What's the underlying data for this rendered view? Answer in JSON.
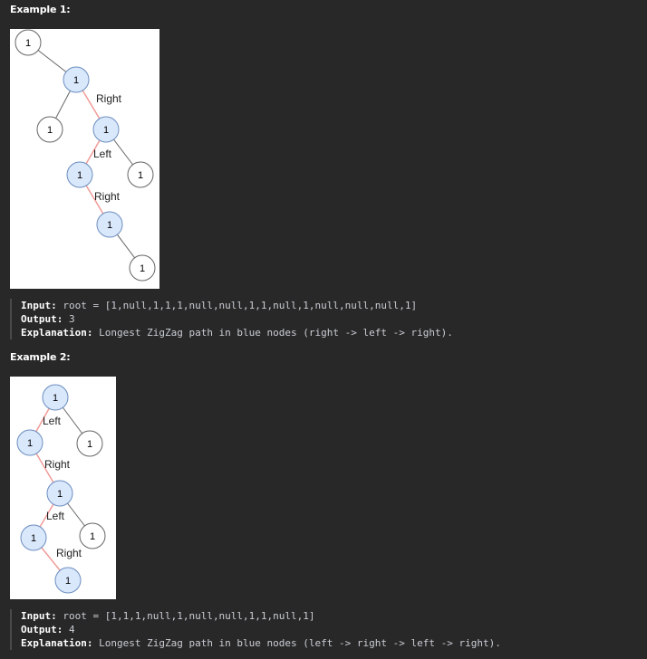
{
  "examples": [
    {
      "heading": "Example 1:",
      "input_label": "Input:",
      "input_value": "root = [1,null,1,1,1,null,null,1,1,null,1,null,null,null,1]",
      "output_label": "Output:",
      "output_value": "3",
      "explanation_label": "Explanation:",
      "explanation_value": "Longest ZigZag path in blue nodes (right -> left -> right).",
      "edge_labels": [
        "Right",
        "Left",
        "Right"
      ],
      "node_value": "1"
    },
    {
      "heading": "Example 2:",
      "input_label": "Input:",
      "input_value": "root = [1,1,1,null,1,null,null,1,1,null,1]",
      "output_label": "Output:",
      "output_value": "4",
      "explanation_label": "Explanation:",
      "explanation_value": "Longest ZigZag path in blue nodes (left -> right -> left -> right).",
      "edge_labels": [
        "Left",
        "Right",
        "Left",
        "Right"
      ],
      "node_value": "1"
    }
  ],
  "colors": {
    "page_background": "#282828",
    "highlight_node_fill": "#dae8fc",
    "highlight_node_stroke": "#6c8ebf",
    "plain_node_stroke": "#666666",
    "zigzag_edge": "#f19c99",
    "plain_edge": "#666666"
  }
}
